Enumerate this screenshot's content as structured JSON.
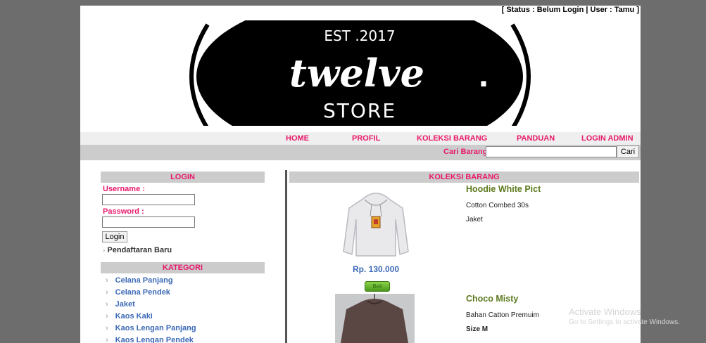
{
  "status": "[ Status : Belum Login | User : Tamu ]",
  "banner": {
    "est": "EST .2017",
    "brand": "twelve",
    "dot": ".",
    "store": "STORE"
  },
  "nav": [
    "HOME",
    "PROFIL",
    "KOLEKSI BARANG",
    "PANDUAN",
    "LOGIN ADMIN"
  ],
  "search": {
    "label": "Cari Barang",
    "value": "",
    "button": "Cari"
  },
  "login": {
    "title": "LOGIN",
    "username_label": "Username :",
    "password_label": "Password :",
    "button": "Login",
    "register": "Pendaftaran Baru"
  },
  "kategori": {
    "title": "KATEGORI",
    "items": [
      "Celana Panjang",
      "Celana Pendek",
      "Jaket",
      "Kaos Kaki",
      "Kaos Lengan Panjang",
      "Kaos Lengan Pendek"
    ]
  },
  "koleksi": {
    "title": "KOLEKSI BARANG",
    "products": [
      {
        "name": "Hoodie White Pict",
        "desc": "Cotton Combed 30s",
        "category": "Jaket",
        "price": "Rp. 130.000",
        "buy": "Beli"
      },
      {
        "name": "Choco Misty",
        "desc": "Bahan Catton Premuim",
        "size": "Size M"
      }
    ]
  },
  "watermark": {
    "title": "Activate Windows",
    "subtitle": "Go to Settings to activate Windows."
  },
  "colors": {
    "accent": "#e8196a",
    "link": "#3d6ab7",
    "product_title": "#5e7a1e",
    "panel": "#cccccc",
    "backdrop": "#6d6d6d"
  }
}
